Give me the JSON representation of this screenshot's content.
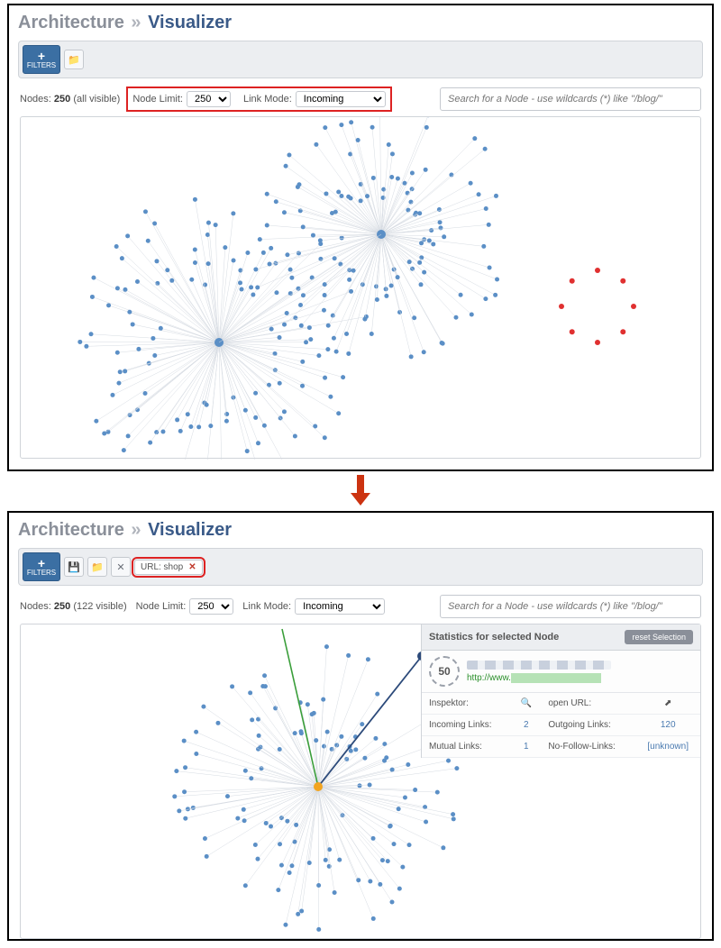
{
  "breadcrumb": {
    "root": "Architecture",
    "sep": "»",
    "current": "Visualizer"
  },
  "filters_label": "FILTERS",
  "folder_icon_name": "folder-icon",
  "close_icon_name": "close-icon",
  "panel1": {
    "nodes_label_prefix": "Nodes:",
    "nodes_count": "250",
    "visible_suffix": "(all visible)",
    "node_limit_label": "Node Limit:",
    "node_limit_value": "250",
    "link_mode_label": "Link Mode:",
    "link_mode_value": "Incoming",
    "search_placeholder": "Search for a Node - use wildcards (*) like \"/blog/\""
  },
  "panel2": {
    "nodes_label_prefix": "Nodes:",
    "nodes_count": "250",
    "visible_suffix": "(122 visible)",
    "node_limit_label": "Node Limit:",
    "node_limit_value": "250",
    "link_mode_label": "Link Mode:",
    "link_mode_value": "Incoming",
    "search_placeholder": "Search for a Node - use wildcards (*) like \"/blog/\"",
    "filter_chip": "URL: shop",
    "stats_header": "Statistics for selected Node",
    "reset_btn": "reset Selection",
    "score": "50",
    "url_prefix": "http://www.",
    "table": {
      "inspektor_label": "Inspektor:",
      "open_url_label": "open URL:",
      "incoming_label": "Incoming Links:",
      "incoming_value": "2",
      "outgoing_label": "Outgoing Links:",
      "outgoing_value": "120",
      "mutual_label": "Mutual Links:",
      "mutual_value": "1",
      "nofollow_label": "No-Follow-Links:",
      "nofollow_value": "[unknown]"
    }
  }
}
